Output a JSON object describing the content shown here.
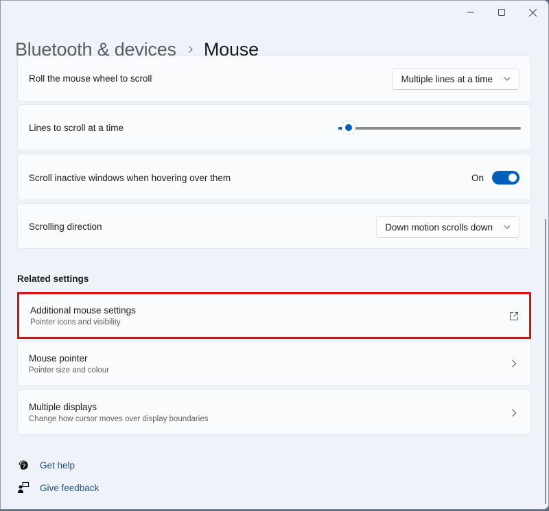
{
  "window": {
    "controls": {
      "minimize": "minimize",
      "maximize": "maximize",
      "close": "close"
    }
  },
  "breadcrumb": {
    "parent": "Bluetooth & devices",
    "separator_icon": "chevron-right-icon",
    "current": "Mouse"
  },
  "settings": {
    "roll_wheel": {
      "label": "Roll the mouse wheel to scroll",
      "value": "Multiple lines at a time"
    },
    "lines_to_scroll": {
      "label": "Lines to scroll at a time",
      "slider_fraction": 0.01
    },
    "scroll_inactive": {
      "label": "Scroll inactive windows when hovering over them",
      "state_label": "On",
      "checked": true
    },
    "scroll_direction": {
      "label": "Scrolling direction",
      "value": "Down motion scrolls down"
    }
  },
  "related": {
    "title": "Related settings",
    "items": [
      {
        "title": "Additional mouse settings",
        "subtitle": "Pointer icons and visibility",
        "icon": "open-external-icon",
        "highlighted": true
      },
      {
        "title": "Mouse pointer",
        "subtitle": "Pointer size and colour",
        "icon": "chevron-right-icon"
      },
      {
        "title": "Multiple displays",
        "subtitle": "Change how cursor moves over display boundaries",
        "icon": "chevron-right-icon"
      }
    ]
  },
  "footer": {
    "get_help": "Get help",
    "give_feedback": "Give feedback"
  },
  "colors": {
    "accent": "#005fb8",
    "highlight": "#e00d0d",
    "link": "#1f4f80",
    "background": "#eff3f9"
  }
}
